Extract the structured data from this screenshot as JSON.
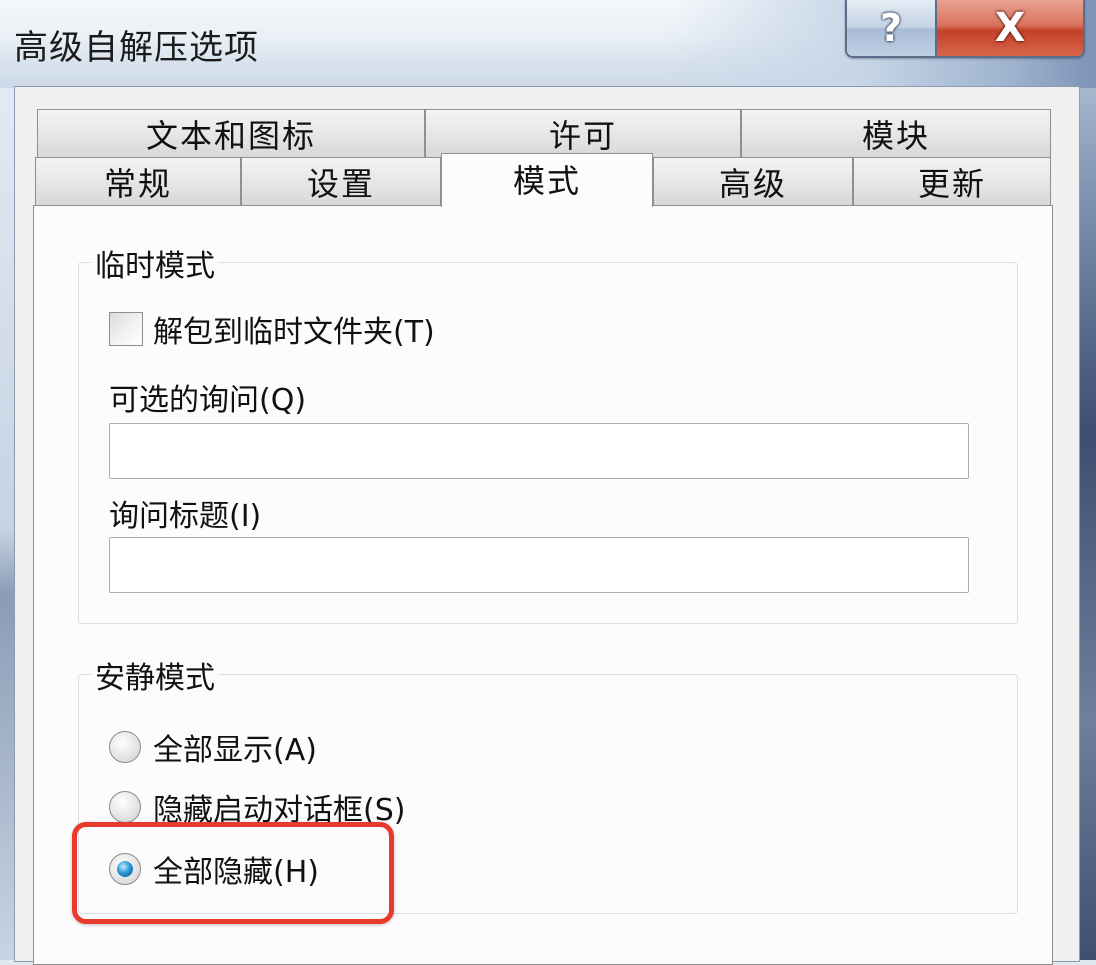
{
  "window": {
    "title": "高级自解压选项",
    "help_label": "?",
    "close_label": "X"
  },
  "tabs": {
    "row_back": [
      "文本和图标",
      "许可",
      "模块"
    ],
    "row_front": [
      "常规",
      "设置",
      "模式",
      "高级",
      "更新"
    ],
    "active": "模式"
  },
  "temp_mode": {
    "group_label": "临时模式",
    "unpack_checkbox": {
      "label": "解包到临时文件夹(T)",
      "checked": false
    },
    "optional_prompt": {
      "label": "可选的询问(Q)",
      "value": ""
    },
    "prompt_title": {
      "label": "询问标题(I)",
      "value": ""
    }
  },
  "silent_mode": {
    "group_label": "安静模式",
    "options": [
      {
        "label": "全部显示(A)",
        "checked": false
      },
      {
        "label": "隐藏启动对话框(S)",
        "checked": false
      },
      {
        "label": "全部隐藏(H)",
        "checked": true
      }
    ]
  },
  "colors": {
    "highlight": "#e8392d",
    "radio_selected": "#2a9bd9"
  }
}
